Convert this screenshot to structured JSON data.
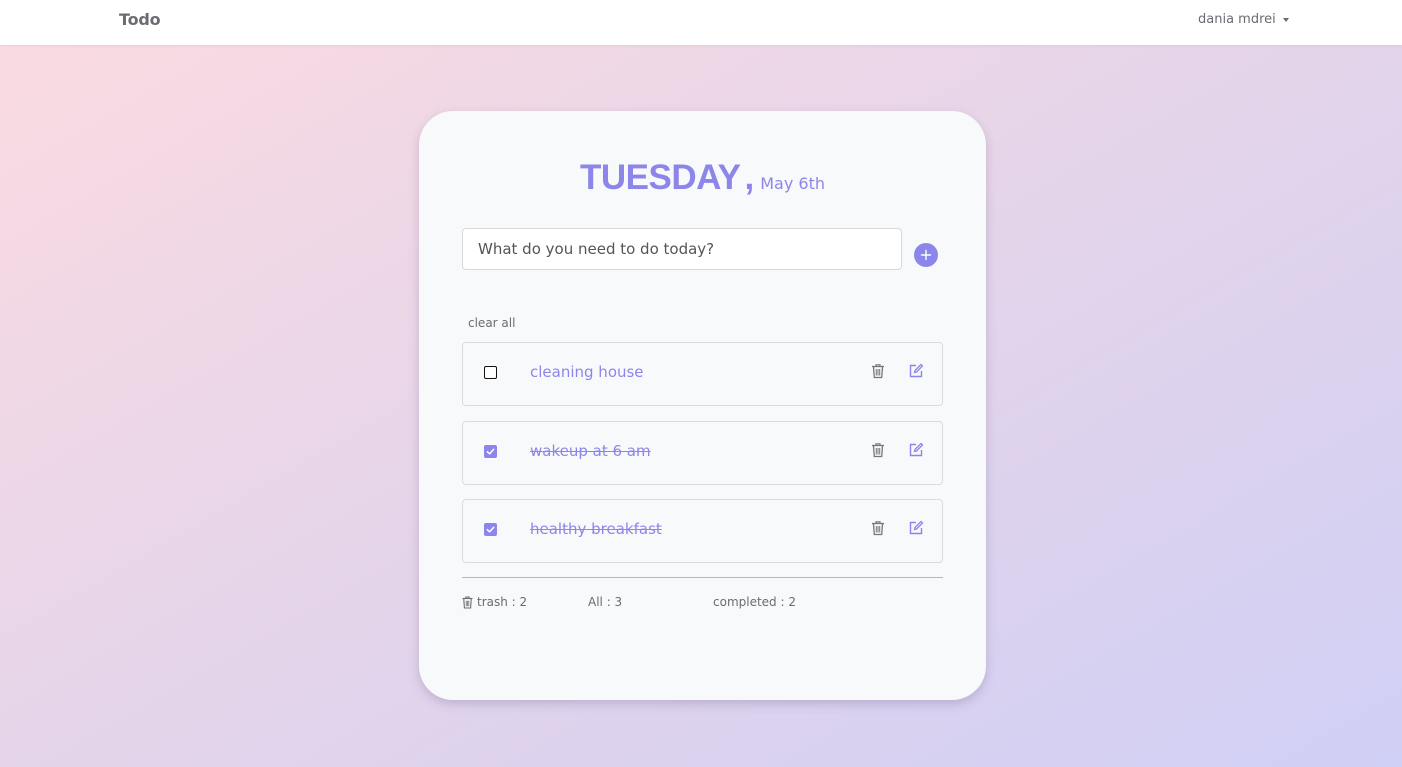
{
  "navbar": {
    "brand": "Todo",
    "user": "dania mdrei"
  },
  "header": {
    "day": "TUESDAY",
    "separator": ",",
    "date": "May 6th"
  },
  "input": {
    "placeholder": "What do you need to do today?",
    "value": ""
  },
  "actions": {
    "clear_all": "clear all"
  },
  "todos": [
    {
      "text": "cleaning house",
      "completed": false
    },
    {
      "text": "wakeup at 6 am",
      "completed": true
    },
    {
      "text": "healthy breakfast",
      "completed": true
    }
  ],
  "footer": {
    "trash": "trash : 2",
    "all": "All : 3",
    "completed": "completed : 2"
  },
  "colors": {
    "accent": "#8c86ea",
    "text_muted": "#6b6b72",
    "card_bg": "#f8f9fa"
  },
  "icons": {
    "add": "plus-icon",
    "delete": "trash-icon",
    "edit": "edit-icon",
    "checkbox": "check-icon",
    "menu": "caret-down-icon"
  }
}
